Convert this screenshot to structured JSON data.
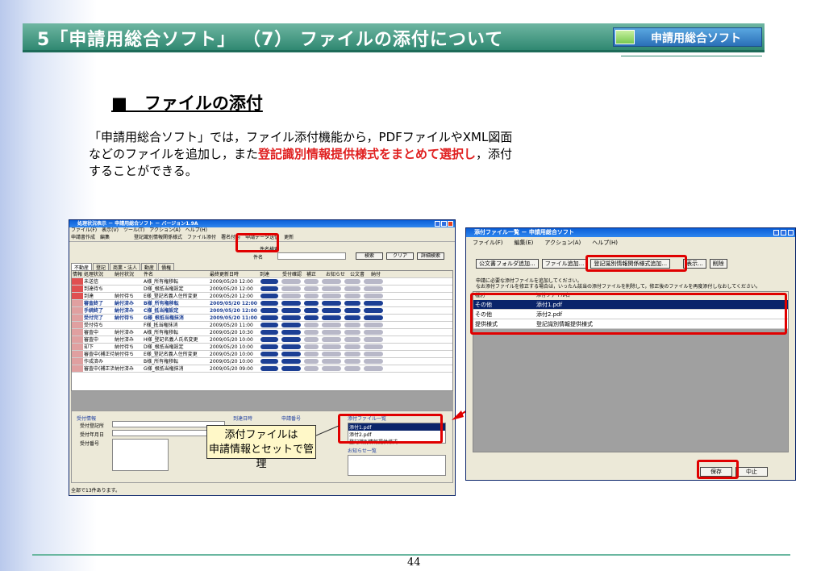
{
  "slide": {
    "title": "5「申請用総合ソフト」 （7） ファイルの添付について",
    "logo": "申請用総合ソフト",
    "heading": "■　ファイルの添付",
    "body_1": "「申請用総合ソフト」では，ファイル添付機能から，PDFファイルやXML図面などのファイルを追加し，また",
    "body_red": "登記識別情報提供様式をまとめて選択し",
    "body_2": "，添付することができる。",
    "callout_1": "添付ファイルは",
    "callout_2": "申請情報とセットで管理",
    "page": "44"
  },
  "left_win": {
    "title": "処理状況表示 － 申請用総合ソフト － バージョン1.9A",
    "menu": [
      "ファイル(F)",
      "表示(V)",
      "ツール(T)",
      "アクション(A)",
      "ヘルプ(H)"
    ],
    "toolbar": [
      "申請書作成",
      "編集",
      "",
      "",
      "",
      "",
      "登記識別情報関係様式",
      "ファイル添付",
      "署名付与",
      "申請データ送信",
      "更新"
    ],
    "search_label": "件名検索",
    "name_label": "件名",
    "search_btns": [
      "検索",
      "クリア",
      "詳細検索"
    ],
    "tabs": [
      "不動産",
      "登記",
      "商業・法人",
      "動産",
      "債権"
    ],
    "headers": [
      "情報",
      "処理状況",
      "納付状況",
      "件名",
      "最終更新日時",
      "到達",
      "受付確認",
      "補正",
      "お知らせ",
      "公文書",
      "納付"
    ],
    "rows": [
      [
        "未送信",
        "",
        "A様_所有権移転",
        "2009/05/20 12:00"
      ],
      [
        "到達待ち",
        "",
        "D様_根抵当権設定",
        "2009/05/20 12:00"
      ],
      [
        "到達",
        "納付待ち",
        "E様_登記名義人住所変更",
        "2009/05/20 12:00"
      ],
      [
        "審査終了",
        "納付済み",
        "B様_所有権移転",
        "2009/05/20 12:00"
      ],
      [
        "手続終了",
        "納付済み",
        "C様_抵当権設定",
        "2009/05/20 12:00"
      ],
      [
        "受付完了",
        "納付待ち",
        "G様_根抵当権抹消",
        "2009/05/20 11:00"
      ],
      [
        "受付待ち",
        "",
        "F様_抵当権抹消",
        "2009/05/20 11:00"
      ],
      [
        "審査中",
        "納付済み",
        "A様_所有権移転",
        "2009/05/20 10:30"
      ],
      [
        "審査中",
        "納付済み",
        "H様_登記名義人氏名変更",
        "2009/05/20 10:00"
      ],
      [
        "却下",
        "納付待ち",
        "D様_根抵当権設定",
        "2009/05/20 10:00"
      ],
      [
        "審査中(補正待ち)",
        "納付待ち",
        "E様_登記名義人住所変更",
        "2009/05/20 10:00"
      ],
      [
        "作成済み",
        "",
        "B様_所有権移転",
        "2009/05/20 10:00"
      ],
      [
        "審査中(補正済み)",
        "納付済み",
        "G様_根抵当権抹消",
        "2009/05/20 09:00"
      ]
    ],
    "bold_rows": [
      3,
      4,
      5
    ],
    "lower_labels": [
      "受付情報",
      "受付登記所",
      "受付年月日",
      "受付番号",
      "到達日時",
      "申請番号",
      "添付ファイル一覧",
      "お知らせ一覧"
    ],
    "attach_list": [
      "添付1.pdf",
      "添付2.pdf",
      "登記識別情報提供様式"
    ],
    "status": "全部で13件あります。"
  },
  "right_win": {
    "title": "添付ファイル一覧 － 申請用総合ソフト",
    "menu": [
      "ファイル(F)",
      "編集(E)",
      "アクション(A)",
      "ヘルプ(H)"
    ],
    "buttons": [
      "公文書フォルダ追加...",
      "ファイル追加...",
      "登記識別情報関係様式追加...",
      "表示...",
      "削除"
    ],
    "note_1": "申請に必要な添付ファイルを追加してください。",
    "note_2": "なお添付ファイルを修正する場合は，いったん該当の添付ファイルを削除して，修正後のファイルを再度添付しなおしてください。",
    "headers": [
      "種別",
      "添付ファイル名"
    ],
    "rows": [
      [
        "その他",
        "添付1.pdf"
      ],
      [
        "その他",
        "添付2.pdf"
      ],
      [
        "提供様式",
        "登記識別情報提供様式"
      ]
    ],
    "save": "保存",
    "cancel": "中止"
  }
}
